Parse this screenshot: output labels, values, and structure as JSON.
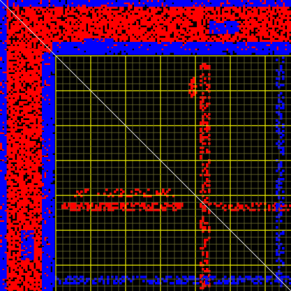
{
  "chart_data": {
    "type": "heatmap",
    "title": "",
    "xlabel": "",
    "ylabel": "",
    "axes_visible": false,
    "grid": true,
    "diagonal_line": true,
    "n_bins": 417,
    "colors": {
      "background": "#000000",
      "positive": "#ff0000",
      "negative": "#0000ff",
      "grid_minor": "#6f6f2e",
      "grid_major": "#e6e600",
      "diagonal": "#cfcfcf"
    },
    "grid_minor_every": 10,
    "grid_major_every": 50,
    "value_legend": [
      "positive",
      "negative"
    ],
    "regions": [
      {
        "sign": "positive",
        "x": [
          0,
          417
        ],
        "y": [
          0,
          70
        ],
        "density": 0.72
      },
      {
        "sign": "positive",
        "x": [
          0,
          70
        ],
        "y": [
          70,
          417
        ],
        "density": 0.72
      },
      {
        "sign": "negative",
        "x": [
          0,
          8
        ],
        "y": [
          0,
          417
        ],
        "density": 0.8
      },
      {
        "sign": "negative",
        "x": [
          0,
          417
        ],
        "y": [
          0,
          8
        ],
        "density": 0.8
      },
      {
        "sign": "negative",
        "x": [
          60,
          78
        ],
        "y": [
          75,
          417
        ],
        "density": 0.85
      },
      {
        "sign": "negative",
        "x": [
          75,
          417
        ],
        "y": [
          60,
          78
        ],
        "density": 0.85
      },
      {
        "sign": "negative",
        "x": [
          300,
          340
        ],
        "y": [
          30,
          48
        ],
        "density": 0.7
      },
      {
        "sign": "negative",
        "x": [
          120,
          160
        ],
        "y": [
          55,
          70
        ],
        "density": 0.7
      },
      {
        "sign": "negative",
        "x": [
          30,
          48
        ],
        "y": [
          330,
          370
        ],
        "density": 0.7
      },
      {
        "sign": "positive",
        "x": [
          88,
          260
        ],
        "y": [
          290,
          300
        ],
        "density": 0.55
      },
      {
        "sign": "positive",
        "x": [
          286,
          300
        ],
        "y": [
          90,
          417
        ],
        "density": 0.35
      },
      {
        "sign": "positive",
        "x": [
          270,
          282
        ],
        "y": [
          110,
          140
        ],
        "density": 0.45
      },
      {
        "sign": "positive",
        "x": [
          300,
          417
        ],
        "y": [
          290,
          302
        ],
        "density": 0.35
      },
      {
        "sign": "negative",
        "x": [
          78,
          417
        ],
        "y": [
          395,
          405
        ],
        "density": 0.45
      },
      {
        "sign": "negative",
        "x": [
          395,
          405
        ],
        "y": [
          78,
          417
        ],
        "density": 0.3
      },
      {
        "sign": "positive",
        "x": [
          100,
          250
        ],
        "y": [
          270,
          280
        ],
        "density": 0.2
      }
    ]
  }
}
